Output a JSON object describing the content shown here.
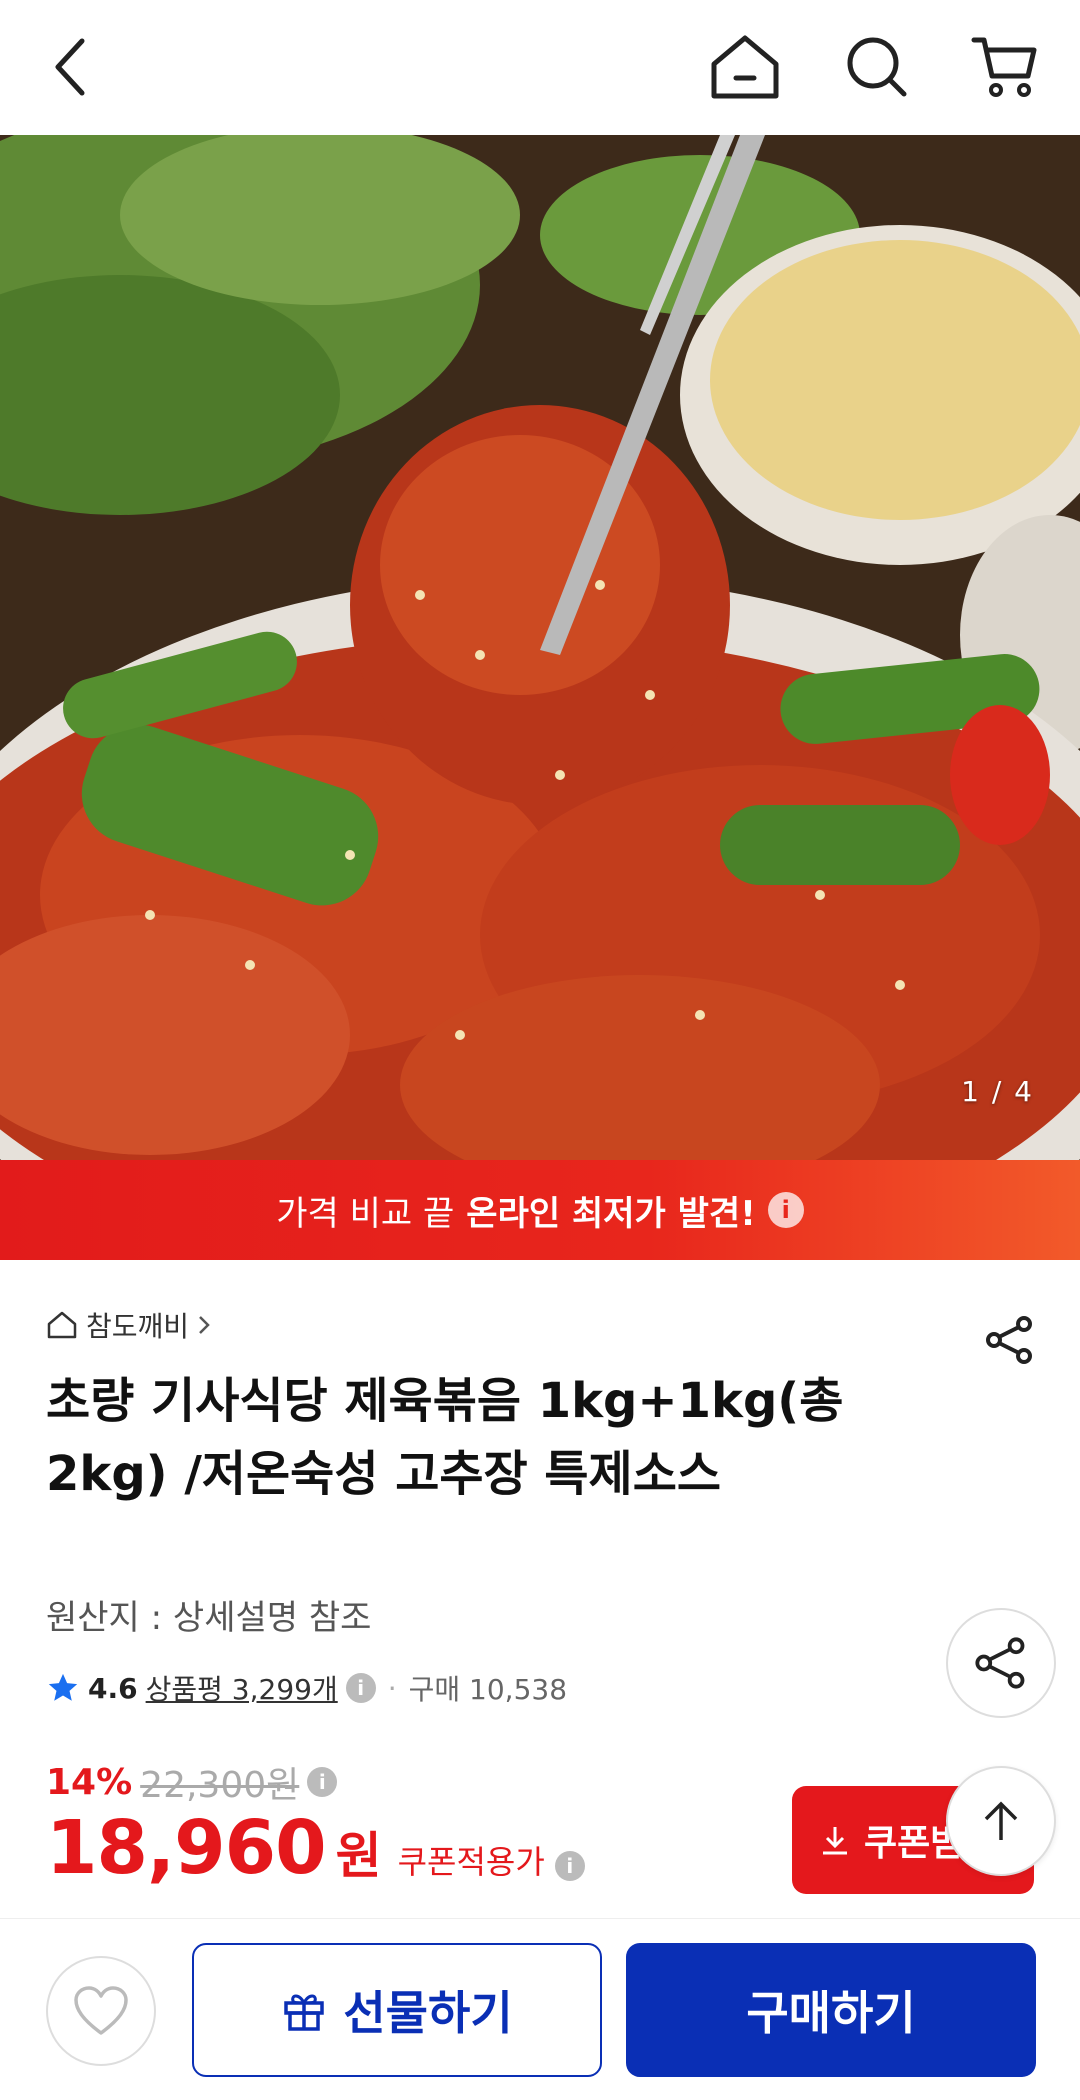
{
  "header": {
    "icons": [
      "chevron-left-icon",
      "home-icon",
      "search-icon",
      "cart-icon"
    ]
  },
  "hero": {
    "counter": "1 / 4"
  },
  "promo": {
    "text_normal": "가격 비교 끝",
    "text_bold": "온라인 최저가 발견!",
    "info_glyph": "i"
  },
  "product": {
    "brand": "참도깨비",
    "title": "초량 기사식당 제육볶음 1kg+1kg(총2kg) /저온숙성 고추장 특제소스",
    "origin": "원산지 : 상세설명 참조",
    "rating": "4.6",
    "reviews": "상품평 3,299개",
    "purchases": "구매 10,538"
  },
  "price": {
    "discount": "14%",
    "original": "22,300원",
    "value": "18,960",
    "unit": "원",
    "coupon_note": "쿠폰적용가"
  },
  "buttons": {
    "coupon": "쿠폰받기",
    "gift": "선물하기",
    "buy": "구매하기"
  },
  "colors": {
    "accent_red": "#e4181c",
    "accent_blue": "#0a2fb5",
    "star": "#1a6ff0"
  }
}
